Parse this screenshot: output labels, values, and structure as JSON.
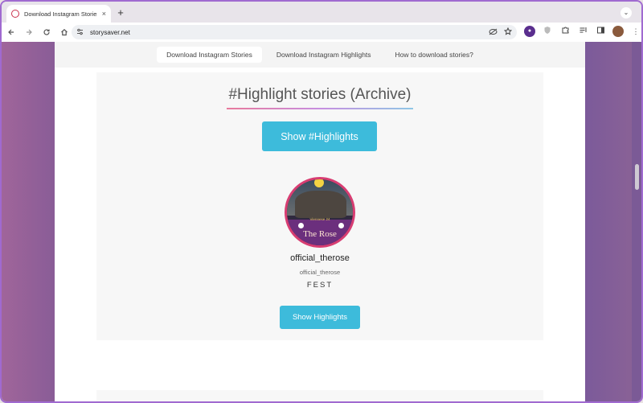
{
  "browser": {
    "tab_title": "Download Instagram Stories",
    "tab_close": "×",
    "new_tab": "+",
    "url": "storysaver.net",
    "profile_menu": "⌄",
    "icons": [
      "back-icon",
      "forward-icon",
      "reload-icon",
      "home-icon",
      "site-info-icon",
      "eye-off-icon",
      "star-icon",
      "extension-icon",
      "shield-icon",
      "puzzle-icon",
      "media-icon",
      "sidebar-icon",
      "avatar-icon",
      "menu-icon"
    ]
  },
  "subnav": {
    "items": [
      {
        "label": "Download Instagram Stories"
      },
      {
        "label": "Download Instagram Highlights"
      },
      {
        "label": "How to download stories?"
      }
    ]
  },
  "highlights": {
    "title": "#Highlight stories (Archive)",
    "show_button": "Show #Highlights"
  },
  "profile": {
    "avatar_text": "The Rose",
    "avatar_subtext": "Viennese 24",
    "username": "official_therose",
    "handle": "official_therose",
    "bio": "FEST",
    "button": "Show Highlights"
  },
  "colors": {
    "accent": "#3dbbdb",
    "avatar_ring": "#d83d72"
  }
}
